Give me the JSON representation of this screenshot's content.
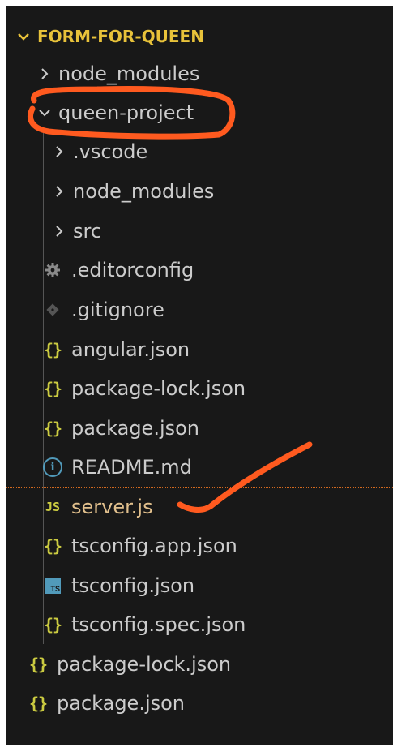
{
  "explorer": {
    "root": {
      "label": "FORM-FOR-QUEEN",
      "expanded": true
    },
    "items": [
      {
        "label": "node_modules",
        "kind": "folder",
        "expanded": false
      },
      {
        "label": "queen-project",
        "kind": "folder",
        "expanded": true
      },
      {
        "label": ".vscode",
        "kind": "folder",
        "expanded": false
      },
      {
        "label": "node_modules",
        "kind": "folder",
        "expanded": false
      },
      {
        "label": "src",
        "kind": "folder",
        "expanded": false
      },
      {
        "label": ".editorconfig",
        "kind": "file",
        "icon": "gear-icon"
      },
      {
        "label": ".gitignore",
        "kind": "file",
        "icon": "git-icon"
      },
      {
        "label": "angular.json",
        "kind": "file",
        "icon": "json-braces-icon",
        "glyph": "{}"
      },
      {
        "label": "package-lock.json",
        "kind": "file",
        "icon": "json-braces-icon",
        "glyph": "{}"
      },
      {
        "label": "package.json",
        "kind": "file",
        "icon": "json-braces-icon",
        "glyph": "{}"
      },
      {
        "label": "README.md",
        "kind": "file",
        "icon": "info-icon",
        "glyph": "i"
      },
      {
        "label": "server.js",
        "kind": "file",
        "icon": "js-icon",
        "glyph": "JS"
      },
      {
        "label": "tsconfig.app.json",
        "kind": "file",
        "icon": "json-braces-icon",
        "glyph": "{}"
      },
      {
        "label": "tsconfig.json",
        "kind": "file",
        "icon": "ts-icon",
        "glyph": "TS"
      },
      {
        "label": "tsconfig.spec.json",
        "kind": "file",
        "icon": "json-braces-icon",
        "glyph": "{}"
      },
      {
        "label": "package-lock.json",
        "kind": "file",
        "icon": "json-braces-icon",
        "glyph": "{}"
      },
      {
        "label": "package.json",
        "kind": "file",
        "icon": "json-braces-icon",
        "glyph": "{}"
      }
    ]
  },
  "colors": {
    "background": "#181818",
    "text": "#cccccc",
    "root_text": "#e8c23a",
    "json_icon": "#cbcb41",
    "js_icon": "#cbcb41",
    "js_label": "#e2c08d",
    "info_icon": "#519aba",
    "ts_icon": "#519aba",
    "annotation": "#ff5a1f"
  }
}
